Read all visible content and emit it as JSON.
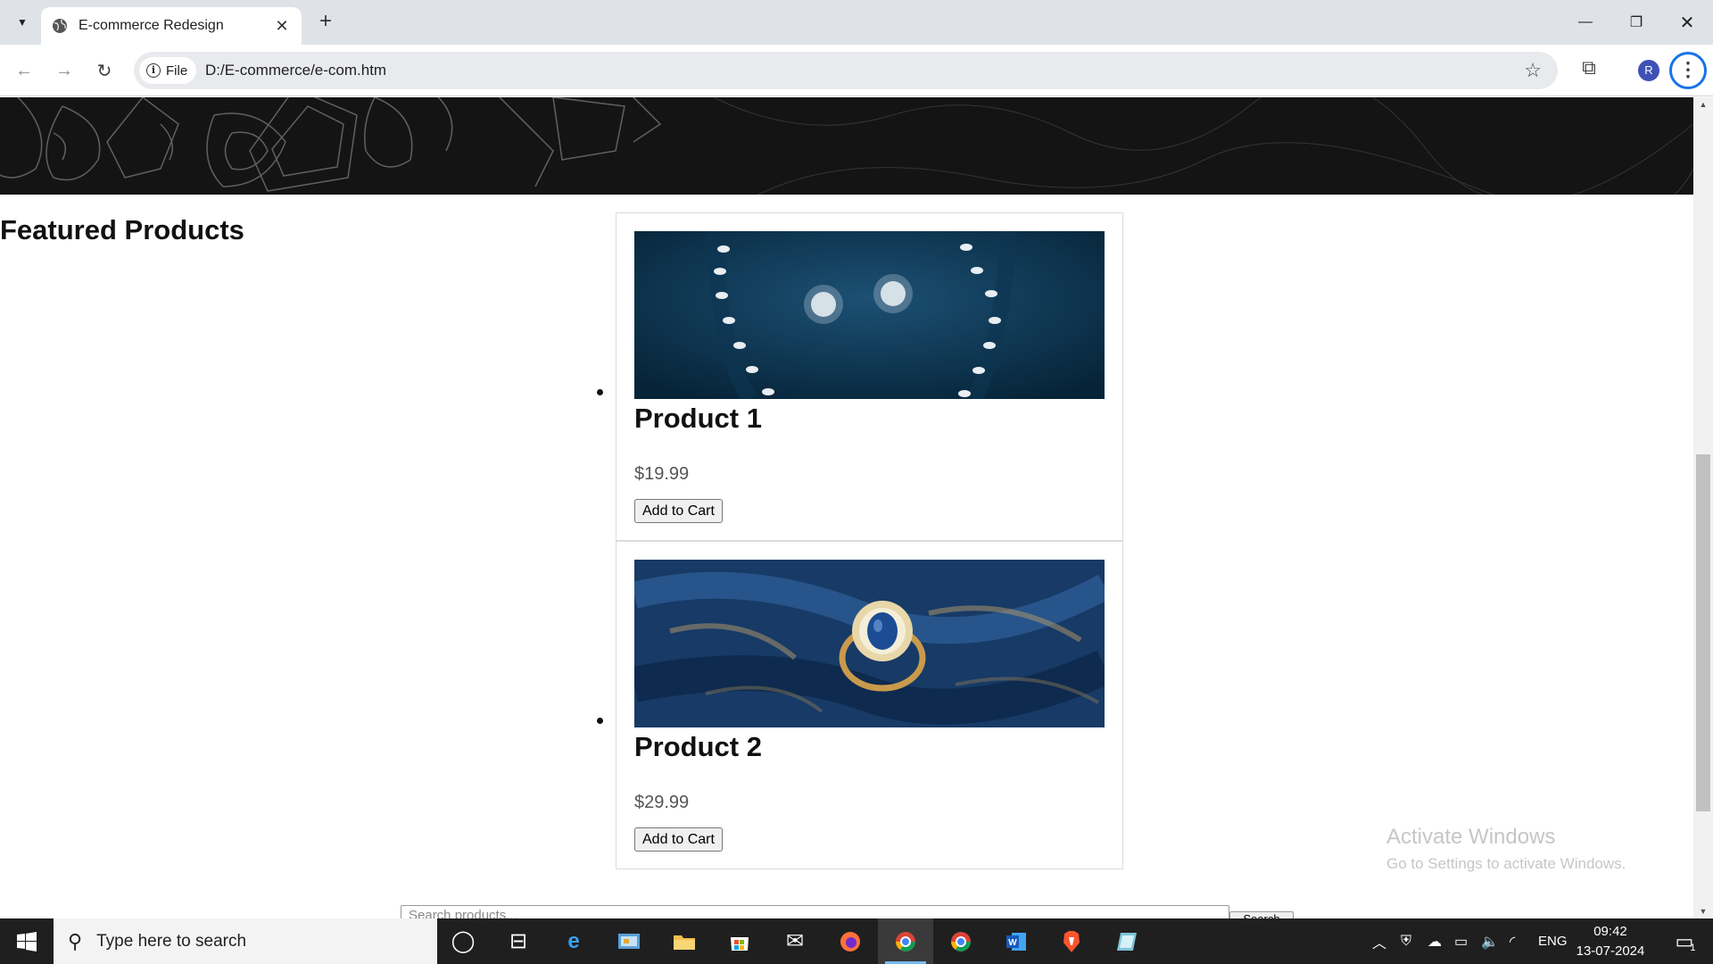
{
  "browser": {
    "tab_title": "E-commerce Redesign",
    "site_chip": "File",
    "url": "D:/E-commerce/e-com.htm",
    "profile_initial": "R"
  },
  "page": {
    "section_title": "Featured Products",
    "products": [
      {
        "name": "Product 1",
        "price": "$19.99",
        "button": "Add to Cart",
        "image": "diamond-necklace-and-earrings"
      },
      {
        "name": "Product 2",
        "price": "$29.99",
        "button": "Add to Cart",
        "image": "sapphire-ring-on-silk"
      }
    ],
    "search_placeholder": "Search products...",
    "search_button": "Search"
  },
  "watermark": {
    "title": "Activate Windows",
    "subtitle": "Go to Settings to activate Windows."
  },
  "taskbar": {
    "search_placeholder": "Type here to search",
    "language": "ENG",
    "time": "09:42",
    "date": "13-07-2024",
    "notification_count": "1",
    "apps": [
      "cortana-icon",
      "task-view-icon",
      "edge-icon",
      "control-panel-icon",
      "file-explorer-icon",
      "store-icon",
      "mail-icon",
      "firefox-icon",
      "chrome-profile-icon",
      "chrome-icon",
      "word-icon",
      "brave-icon",
      "notepad-icon"
    ]
  }
}
